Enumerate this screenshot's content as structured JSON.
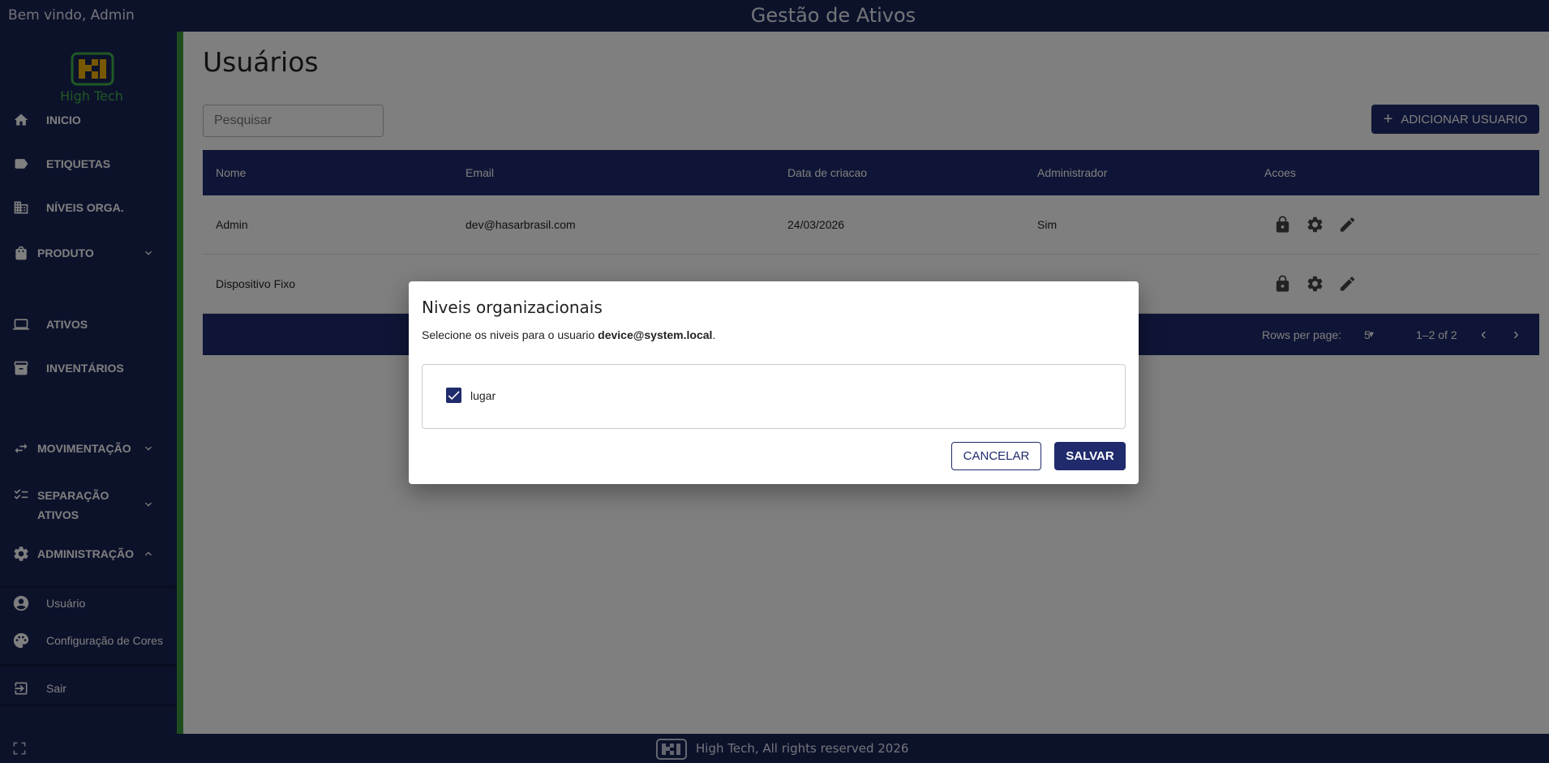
{
  "topbar": {
    "welcome": "Bem vindo, Admin",
    "app_title": "Gestão de Ativos"
  },
  "sidebar": {
    "logo_text": "High Tech",
    "items": [
      {
        "label": "INICIO",
        "icon": "home-icon"
      },
      {
        "label": "ETIQUETAS",
        "icon": "label-icon"
      },
      {
        "label": "NÍVEIS ORGA.",
        "icon": "building-icon"
      },
      {
        "label": "PRODUTO",
        "icon": "bag-icon"
      },
      {
        "label": "ATIVOS",
        "icon": "laptop-icon"
      },
      {
        "label": "INVENTÁRIOS",
        "icon": "archive-icon"
      },
      {
        "label": "MOVIMENTAÇÃO",
        "icon": "swap-icon"
      },
      {
        "label": "SEPARAÇÃO",
        "label2": "ATIVOS",
        "icon": "checklist-icon"
      },
      {
        "label": "ADMINISTRAÇÃO",
        "icon": "gear-icon"
      }
    ],
    "sub_items": [
      {
        "label": "Usuário",
        "icon": "user-circle-icon"
      },
      {
        "label": "Configuração de Cores",
        "icon": "palette-icon"
      }
    ],
    "logout": {
      "label": "Sair",
      "icon": "logout-icon"
    }
  },
  "main": {
    "title": "Usuários",
    "search_placeholder": "Pesquisar",
    "add_button": "ADICIONAR USUARIO",
    "table": {
      "headers": [
        "Nome",
        "Email",
        "Data de criacao",
        "Administrador",
        "Acoes"
      ],
      "rows": [
        {
          "nome": "Admin",
          "email": "dev@hasarbrasil.com",
          "data": "24/03/2026",
          "admin": "Sim"
        },
        {
          "nome": "Dispositivo Fixo",
          "email": "",
          "data": "",
          "admin": ""
        }
      ],
      "rows_per_page_label": "Rows per page:",
      "rows_per_page": "5",
      "range": "1–2 of 2"
    }
  },
  "footer": {
    "text": "High Tech, All rights reserved 2026"
  },
  "dialog": {
    "title": "Niveis organizacionais",
    "subtitle_prefix": "Selecione os niveis para o usuario ",
    "subtitle_user": "device@system.local",
    "subtitle_suffix": ".",
    "option_label": "lugar",
    "option_checked": true,
    "cancel": "CANCELAR",
    "save": "SALVAR"
  },
  "colors": {
    "navy": "#1a2456",
    "primary": "#1f2b6c",
    "green_accent": "#3a9a3e",
    "logo_green": "#3fb34a",
    "logo_yellow": "#f0b000"
  }
}
